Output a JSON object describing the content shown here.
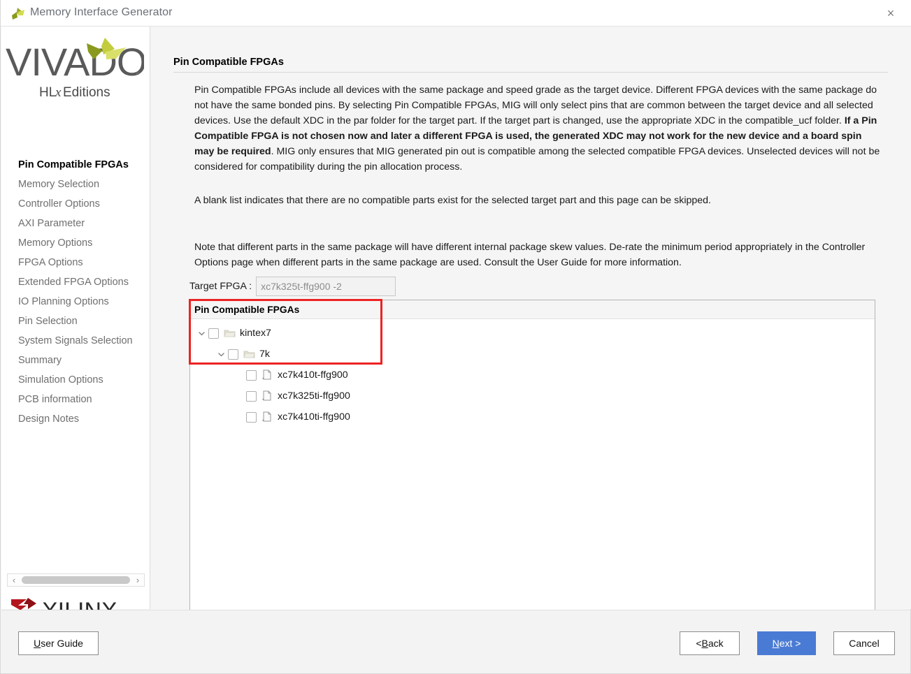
{
  "window": {
    "title": "Memory Interface Generator",
    "app_icon": "vivado-logo-icon",
    "close_label": "×"
  },
  "sidebar": {
    "logo_primary": "VIVADO",
    "logo_secondary": "HLx Editions",
    "footer_logo": "XILINX",
    "scroll_left": "‹",
    "scroll_right": "›",
    "items": [
      {
        "label": "Pin Compatible FPGAs",
        "active": true
      },
      {
        "label": "Memory Selection",
        "active": false
      },
      {
        "label": "Controller Options",
        "active": false
      },
      {
        "label": "AXI Parameter",
        "active": false
      },
      {
        "label": "Memory Options",
        "active": false
      },
      {
        "label": "FPGA Options",
        "active": false
      },
      {
        "label": "Extended FPGA Options",
        "active": false
      },
      {
        "label": "IO Planning Options",
        "active": false
      },
      {
        "label": "Pin Selection",
        "active": false
      },
      {
        "label": "System Signals Selection",
        "active": false
      },
      {
        "label": "Summary",
        "active": false
      },
      {
        "label": "Simulation Options",
        "active": false
      },
      {
        "label": "PCB information",
        "active": false
      },
      {
        "label": "Design Notes",
        "active": false
      }
    ]
  },
  "main": {
    "page_title": "Pin Compatible FPGAs",
    "paragraph_1_part_a": "Pin Compatible FPGAs include all devices with the same package and speed grade as the target device. Different FPGA devices with the same package do not have the same bonded pins. By selecting Pin Compatible FPGAs, MIG will only select pins that are common between the target device and all selected devices. Use the default XDC in the par folder for the target part. If the target part is changed, use the appropriate XDC in the compatible_ucf folder. ",
    "paragraph_1_bold": "If a Pin Compatible FPGA is not chosen now and later a different FPGA is used, the generated XDC may not work for the new device and a board spin may be required",
    "paragraph_1_part_b": ". MIG only ensures that MIG generated pin out is compatible among the selected compatible FPGA devices. Unselected devices will not be considered for compatibility during the pin allocation process.",
    "paragraph_2": "A blank list indicates that there are no compatible parts exist for the selected target part and this page can be skipped.",
    "paragraph_3": "Note that different parts in the same package will have different internal package skew values. De-rate the minimum period appropriately in the Controller Options page when different parts in the same package are used. Consult the User Guide for more information.",
    "target_fpga_label": "Target FPGA :",
    "target_fpga_value": "xc7k325t-ffg900 -2"
  },
  "tree": {
    "header": "Pin Compatible FPGAs",
    "highlight_color": "#ee2222",
    "rows": [
      {
        "label": "kintex7",
        "indent": 0,
        "icon": "folder-icon",
        "twisty": "chevron-down-icon",
        "checked": false
      },
      {
        "label": "7k",
        "indent": 1,
        "icon": "folder-icon",
        "twisty": "chevron-down-icon",
        "checked": false
      },
      {
        "label": "xc7k410t-ffg900",
        "indent": 2,
        "icon": "document-icon",
        "twisty": "",
        "checked": false
      },
      {
        "label": "xc7k325ti-ffg900",
        "indent": 2,
        "icon": "document-icon",
        "twisty": "",
        "checked": false
      },
      {
        "label": "xc7k410ti-ffg900",
        "indent": 2,
        "icon": "document-icon",
        "twisty": "",
        "checked": false
      }
    ]
  },
  "footer": {
    "user_guide": {
      "pre": "",
      "mnemonic": "U",
      "post": "ser Guide"
    },
    "back": {
      "pre": "< ",
      "mnemonic": "B",
      "post": "ack"
    },
    "next": {
      "pre": "",
      "mnemonic": "N",
      "post": "ext >"
    },
    "cancel": {
      "pre": "Cancel",
      "mnemonic": "",
      "post": ""
    },
    "next_color": "#4a7bd4"
  }
}
